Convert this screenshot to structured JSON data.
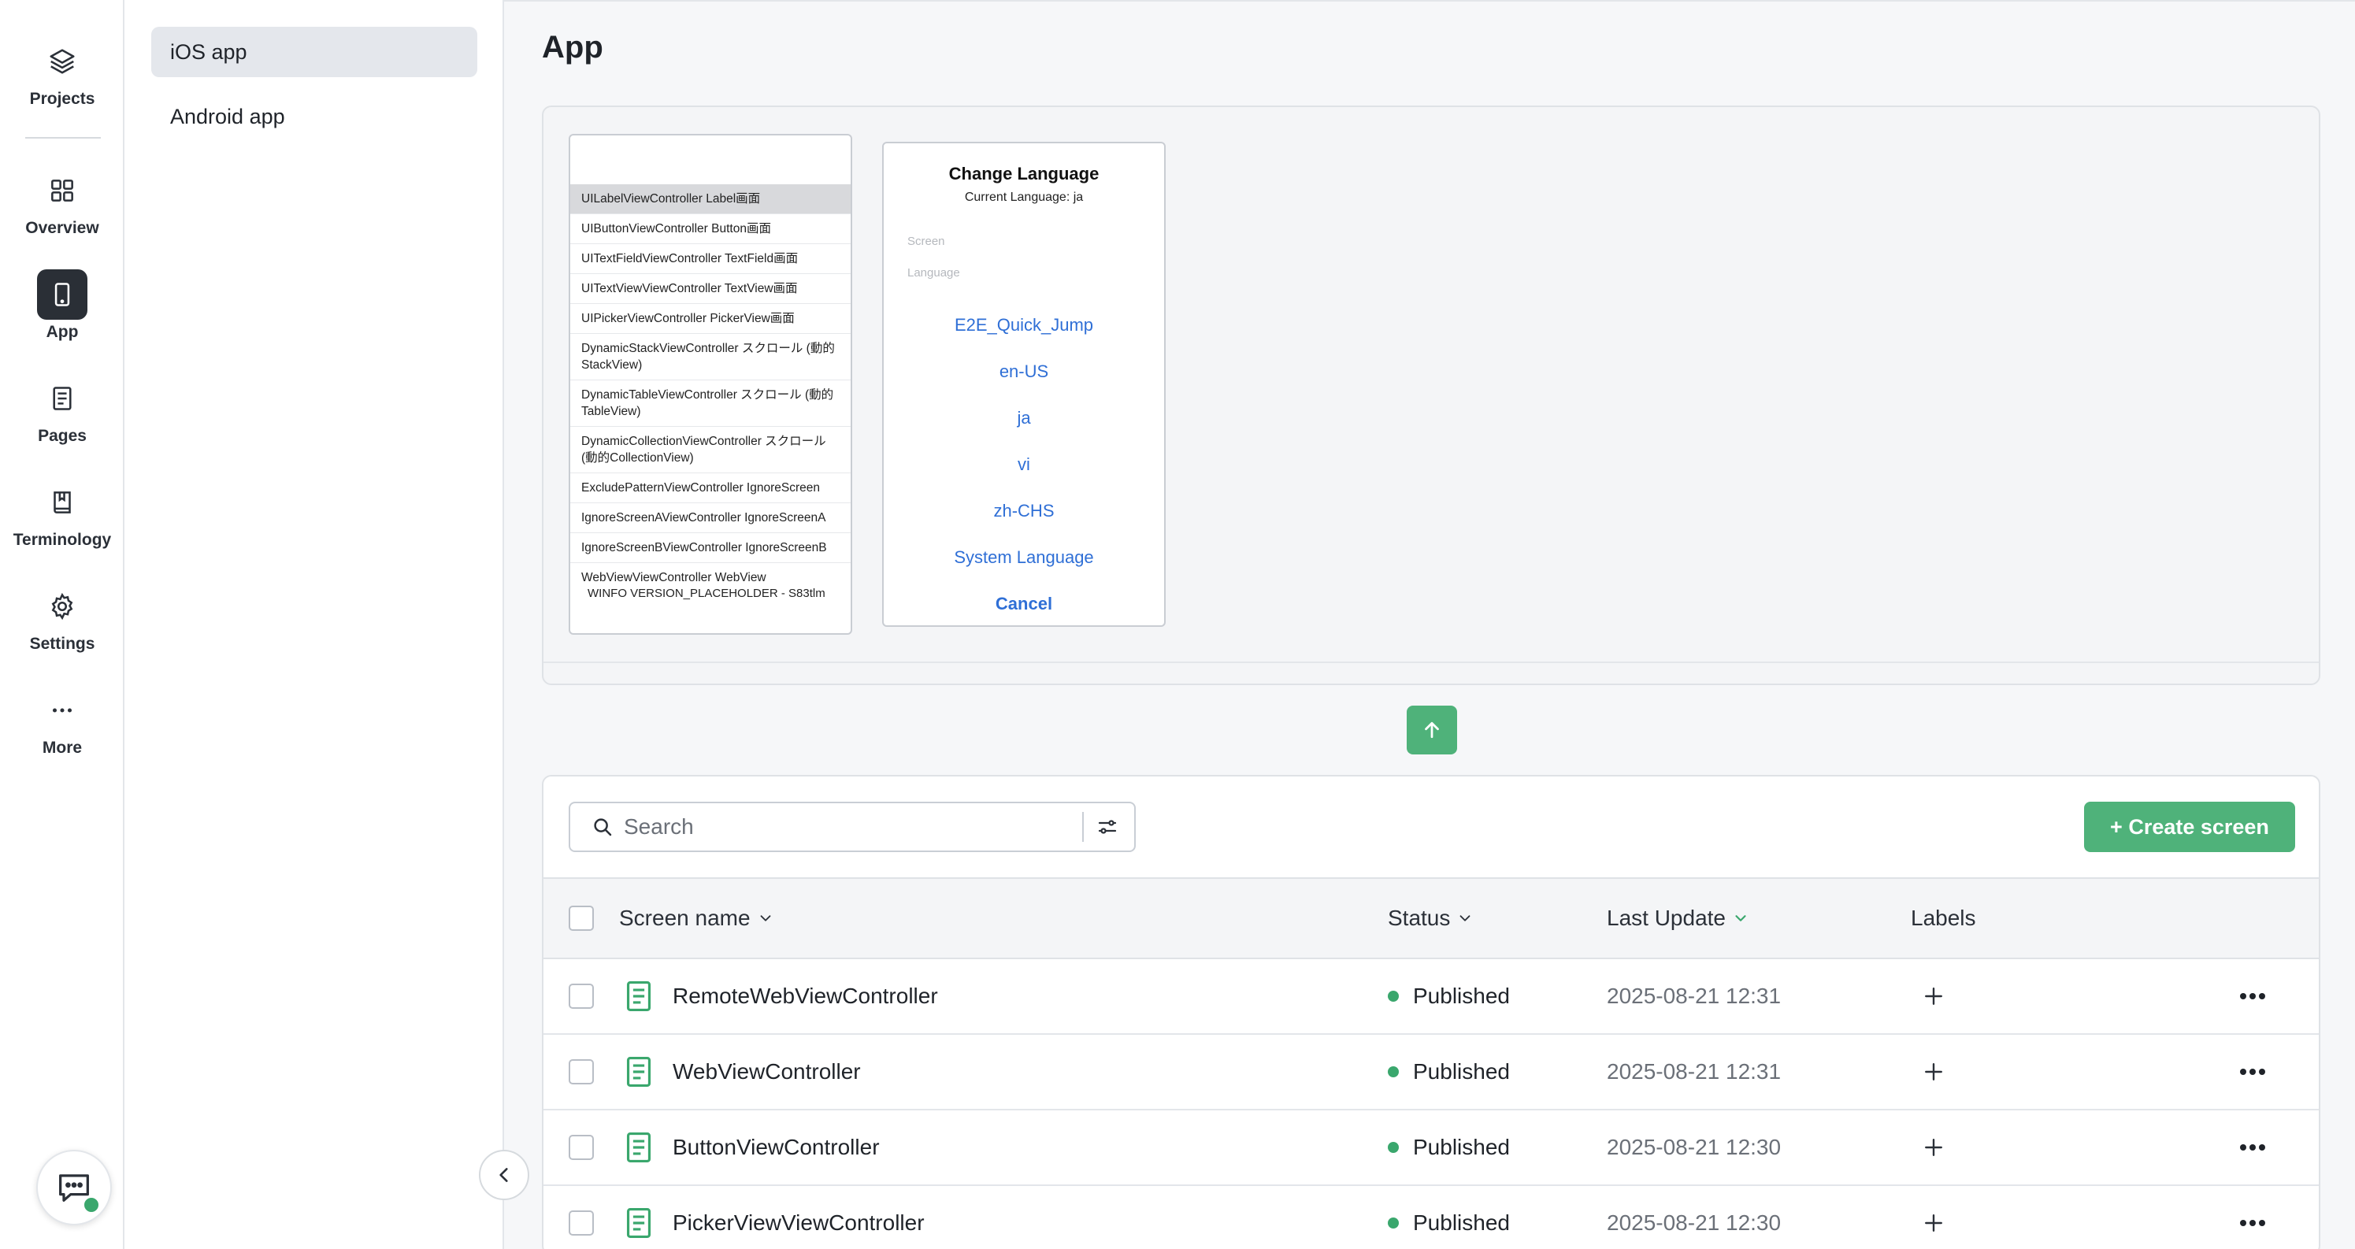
{
  "rail": {
    "items": [
      {
        "label": "Projects",
        "icon": "layers-icon"
      },
      {
        "label": "Overview",
        "icon": "grid-icon"
      },
      {
        "label": "App",
        "icon": "phone-icon"
      },
      {
        "label": "Pages",
        "icon": "document-icon"
      },
      {
        "label": "Terminology",
        "icon": "book-icon"
      },
      {
        "label": "Settings",
        "icon": "gear-icon"
      },
      {
        "label": "More",
        "icon": "more-icon"
      }
    ],
    "active": "App"
  },
  "panel": {
    "items": [
      {
        "label": "iOS app"
      },
      {
        "label": "Android app"
      }
    ]
  },
  "main": {
    "title": "App",
    "preview": {
      "phone1_rows": [
        "UILabelViewController Label画面",
        "UIButtonViewController Button画面",
        "UITextFieldViewController TextField画面",
        "UITextViewViewController TextView画面",
        "UIPickerViewController PickerView画面",
        "DynamicStackViewController スクロール (動的StackView)",
        "DynamicTableViewController スクロール (動的TableView)",
        "DynamicCollectionViewController スクロール (動的CollectionView)",
        "ExcludePatternViewController IgnoreScreen",
        "IgnoreScreenAViewController IgnoreScreenA",
        "IgnoreScreenBViewController IgnoreScreenB",
        "WebViewViewController WebView",
        "WINFO VERSION_PLACEHOLDER - S83tlm"
      ],
      "dialog": {
        "title": "Change Language",
        "subtitle": "Current Language: ja",
        "field_screen": "Screen",
        "field_language": "Language",
        "options": [
          "E2E_Quick_Jump",
          "en-US",
          "ja",
          "vi",
          "zh-CHS",
          "System Language"
        ],
        "cancel": "Cancel"
      }
    },
    "toolbar": {
      "search_placeholder": "Search",
      "create_label": "+ Create screen"
    },
    "table": {
      "columns": {
        "name": "Screen name",
        "status": "Status",
        "last_update": "Last Update",
        "labels": "Labels"
      },
      "rows": [
        {
          "name": "RemoteWebViewController",
          "status": "Published",
          "last_update": "2025-08-21 12:31"
        },
        {
          "name": "WebViewController",
          "status": "Published",
          "last_update": "2025-08-21 12:31"
        },
        {
          "name": "ButtonViewController",
          "status": "Published",
          "last_update": "2025-08-21 12:30"
        },
        {
          "name": "PickerViewViewController",
          "status": "Published",
          "last_update": "2025-08-21 12:30"
        }
      ]
    }
  },
  "colors": {
    "accent": "#4fb27a",
    "status_published": "#3aa76d",
    "link": "#2f6fd6",
    "active_rail": "#2a2f36"
  }
}
